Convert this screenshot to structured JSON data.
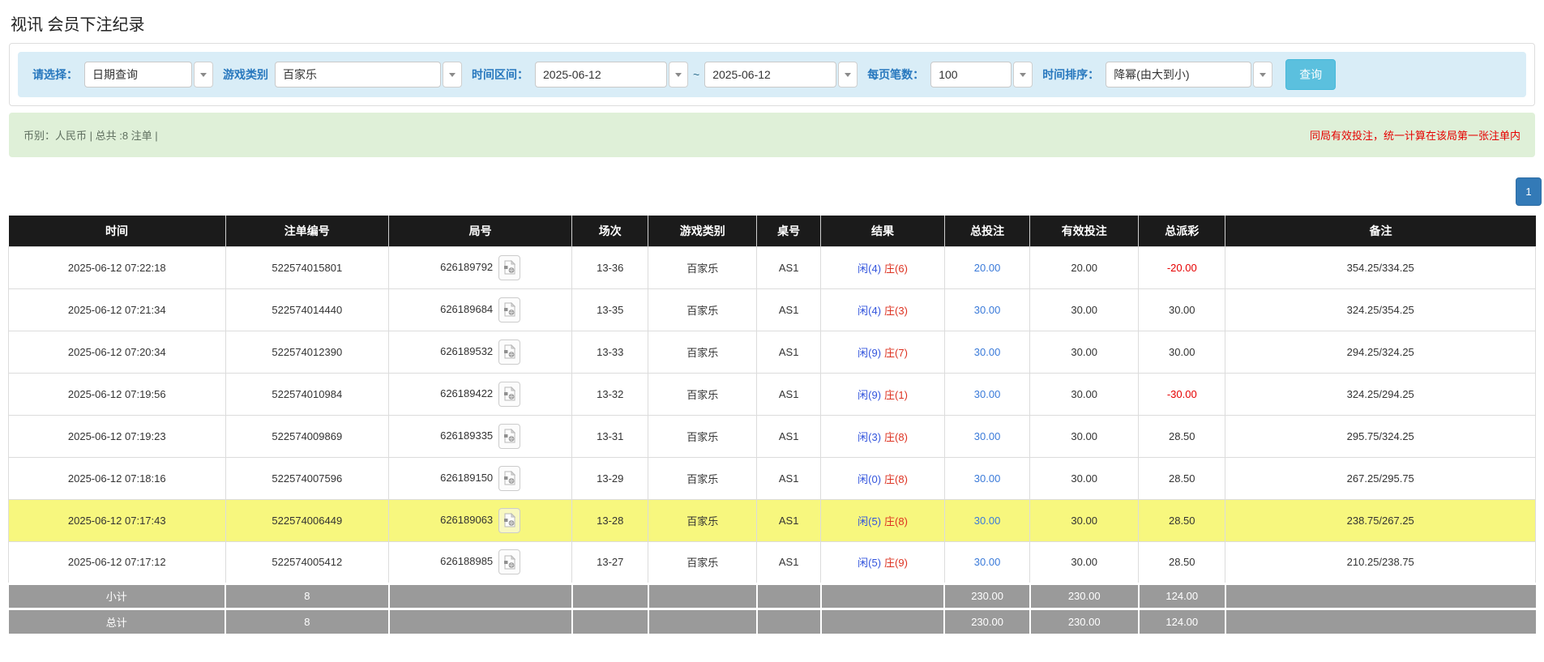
{
  "title": "视讯 会员下注纪录",
  "filters": {
    "select_label": "请选择：",
    "select_value": "日期查询",
    "game_label": "游戏类别",
    "game_value": "百家乐",
    "range_label": "时间区间：",
    "date_from": "2025-06-12",
    "range_sep": "~",
    "date_to": "2025-06-12",
    "pagesize_label": "每页笔数：",
    "pagesize_value": "100",
    "sort_label": "时间排序：",
    "sort_value": "降幂(由大到小)",
    "search_label": "查询"
  },
  "summary": {
    "left": "币别：人民币 | 总共 :8 注单 |",
    "right": "同局有效投注，统一计算在该局第一张注单内"
  },
  "pagination": {
    "page": "1"
  },
  "table": {
    "columns": [
      "时间",
      "注单编号",
      "局号",
      "场次",
      "游戏类别",
      "桌号",
      "结果",
      "总投注",
      "有效投注",
      "总派彩",
      "备注"
    ],
    "column_keys": [
      "time",
      "bet-id",
      "round-id",
      "session",
      "game-type",
      "table-no",
      "result",
      "total-bet",
      "valid-bet",
      "payout",
      "remark"
    ],
    "rows": [
      {
        "time": "2025-06-12 07:22:18",
        "bet_id": "522574015801",
        "round_id": "626189792",
        "session": "13-36",
        "game": "百家乐",
        "table": "AS1",
        "player": "闲(4)",
        "banker": "庄(6)",
        "total_bet": "20.00",
        "valid_bet": "20.00",
        "payout": "-20.00",
        "remark": "354.25/334.25",
        "highlighted": false
      },
      {
        "time": "2025-06-12 07:21:34",
        "bet_id": "522574014440",
        "round_id": "626189684",
        "session": "13-35",
        "game": "百家乐",
        "table": "AS1",
        "player": "闲(4)",
        "banker": "庄(3)",
        "total_bet": "30.00",
        "valid_bet": "30.00",
        "payout": "30.00",
        "remark": "324.25/354.25",
        "highlighted": false
      },
      {
        "time": "2025-06-12 07:20:34",
        "bet_id": "522574012390",
        "round_id": "626189532",
        "session": "13-33",
        "game": "百家乐",
        "table": "AS1",
        "player": "闲(9)",
        "banker": "庄(7)",
        "total_bet": "30.00",
        "valid_bet": "30.00",
        "payout": "30.00",
        "remark": "294.25/324.25",
        "highlighted": false
      },
      {
        "time": "2025-06-12 07:19:56",
        "bet_id": "522574010984",
        "round_id": "626189422",
        "session": "13-32",
        "game": "百家乐",
        "table": "AS1",
        "player": "闲(9)",
        "banker": "庄(1)",
        "total_bet": "30.00",
        "valid_bet": "30.00",
        "payout": "-30.00",
        "remark": "324.25/294.25",
        "highlighted": false
      },
      {
        "time": "2025-06-12 07:19:23",
        "bet_id": "522574009869",
        "round_id": "626189335",
        "session": "13-31",
        "game": "百家乐",
        "table": "AS1",
        "player": "闲(3)",
        "banker": "庄(8)",
        "total_bet": "30.00",
        "valid_bet": "30.00",
        "payout": "28.50",
        "remark": "295.75/324.25",
        "highlighted": false
      },
      {
        "time": "2025-06-12 07:18:16",
        "bet_id": "522574007596",
        "round_id": "626189150",
        "session": "13-29",
        "game": "百家乐",
        "table": "AS1",
        "player": "闲(0)",
        "banker": "庄(8)",
        "total_bet": "30.00",
        "valid_bet": "30.00",
        "payout": "28.50",
        "remark": "267.25/295.75",
        "highlighted": false
      },
      {
        "time": "2025-06-12 07:17:43",
        "bet_id": "522574006449",
        "round_id": "626189063",
        "session": "13-28",
        "game": "百家乐",
        "table": "AS1",
        "player": "闲(5)",
        "banker": "庄(8)",
        "total_bet": "30.00",
        "valid_bet": "30.00",
        "payout": "28.50",
        "remark": "238.75/267.25",
        "highlighted": true
      },
      {
        "time": "2025-06-12 07:17:12",
        "bet_id": "522574005412",
        "round_id": "626188985",
        "session": "13-27",
        "game": "百家乐",
        "table": "AS1",
        "player": "闲(5)",
        "banker": "庄(9)",
        "total_bet": "30.00",
        "valid_bet": "30.00",
        "payout": "28.50",
        "remark": "210.25/238.75",
        "highlighted": false
      }
    ],
    "footer_rows": [
      {
        "label": "小计",
        "count": "8",
        "total_bet": "230.00",
        "valid_bet": "230.00",
        "payout": "124.00"
      },
      {
        "label": "总计",
        "count": "8",
        "total_bet": "230.00",
        "valid_bet": "230.00",
        "payout": "124.00"
      }
    ]
  },
  "colors": {
    "accent_search": "#5bc0de",
    "pagination": "#337ab7",
    "player_blue": "#3355dd",
    "banker_red": "#dd3322",
    "bet_link_blue": "#3a7ad9",
    "negative_red": "#e60000",
    "highlight_yellow": "#f7f77e",
    "filter_bar_bg": "#d9edf7",
    "summary_bg": "#dff0d8",
    "header_bg": "#1b1b1b",
    "footer_bg": "#9a9a9a"
  }
}
